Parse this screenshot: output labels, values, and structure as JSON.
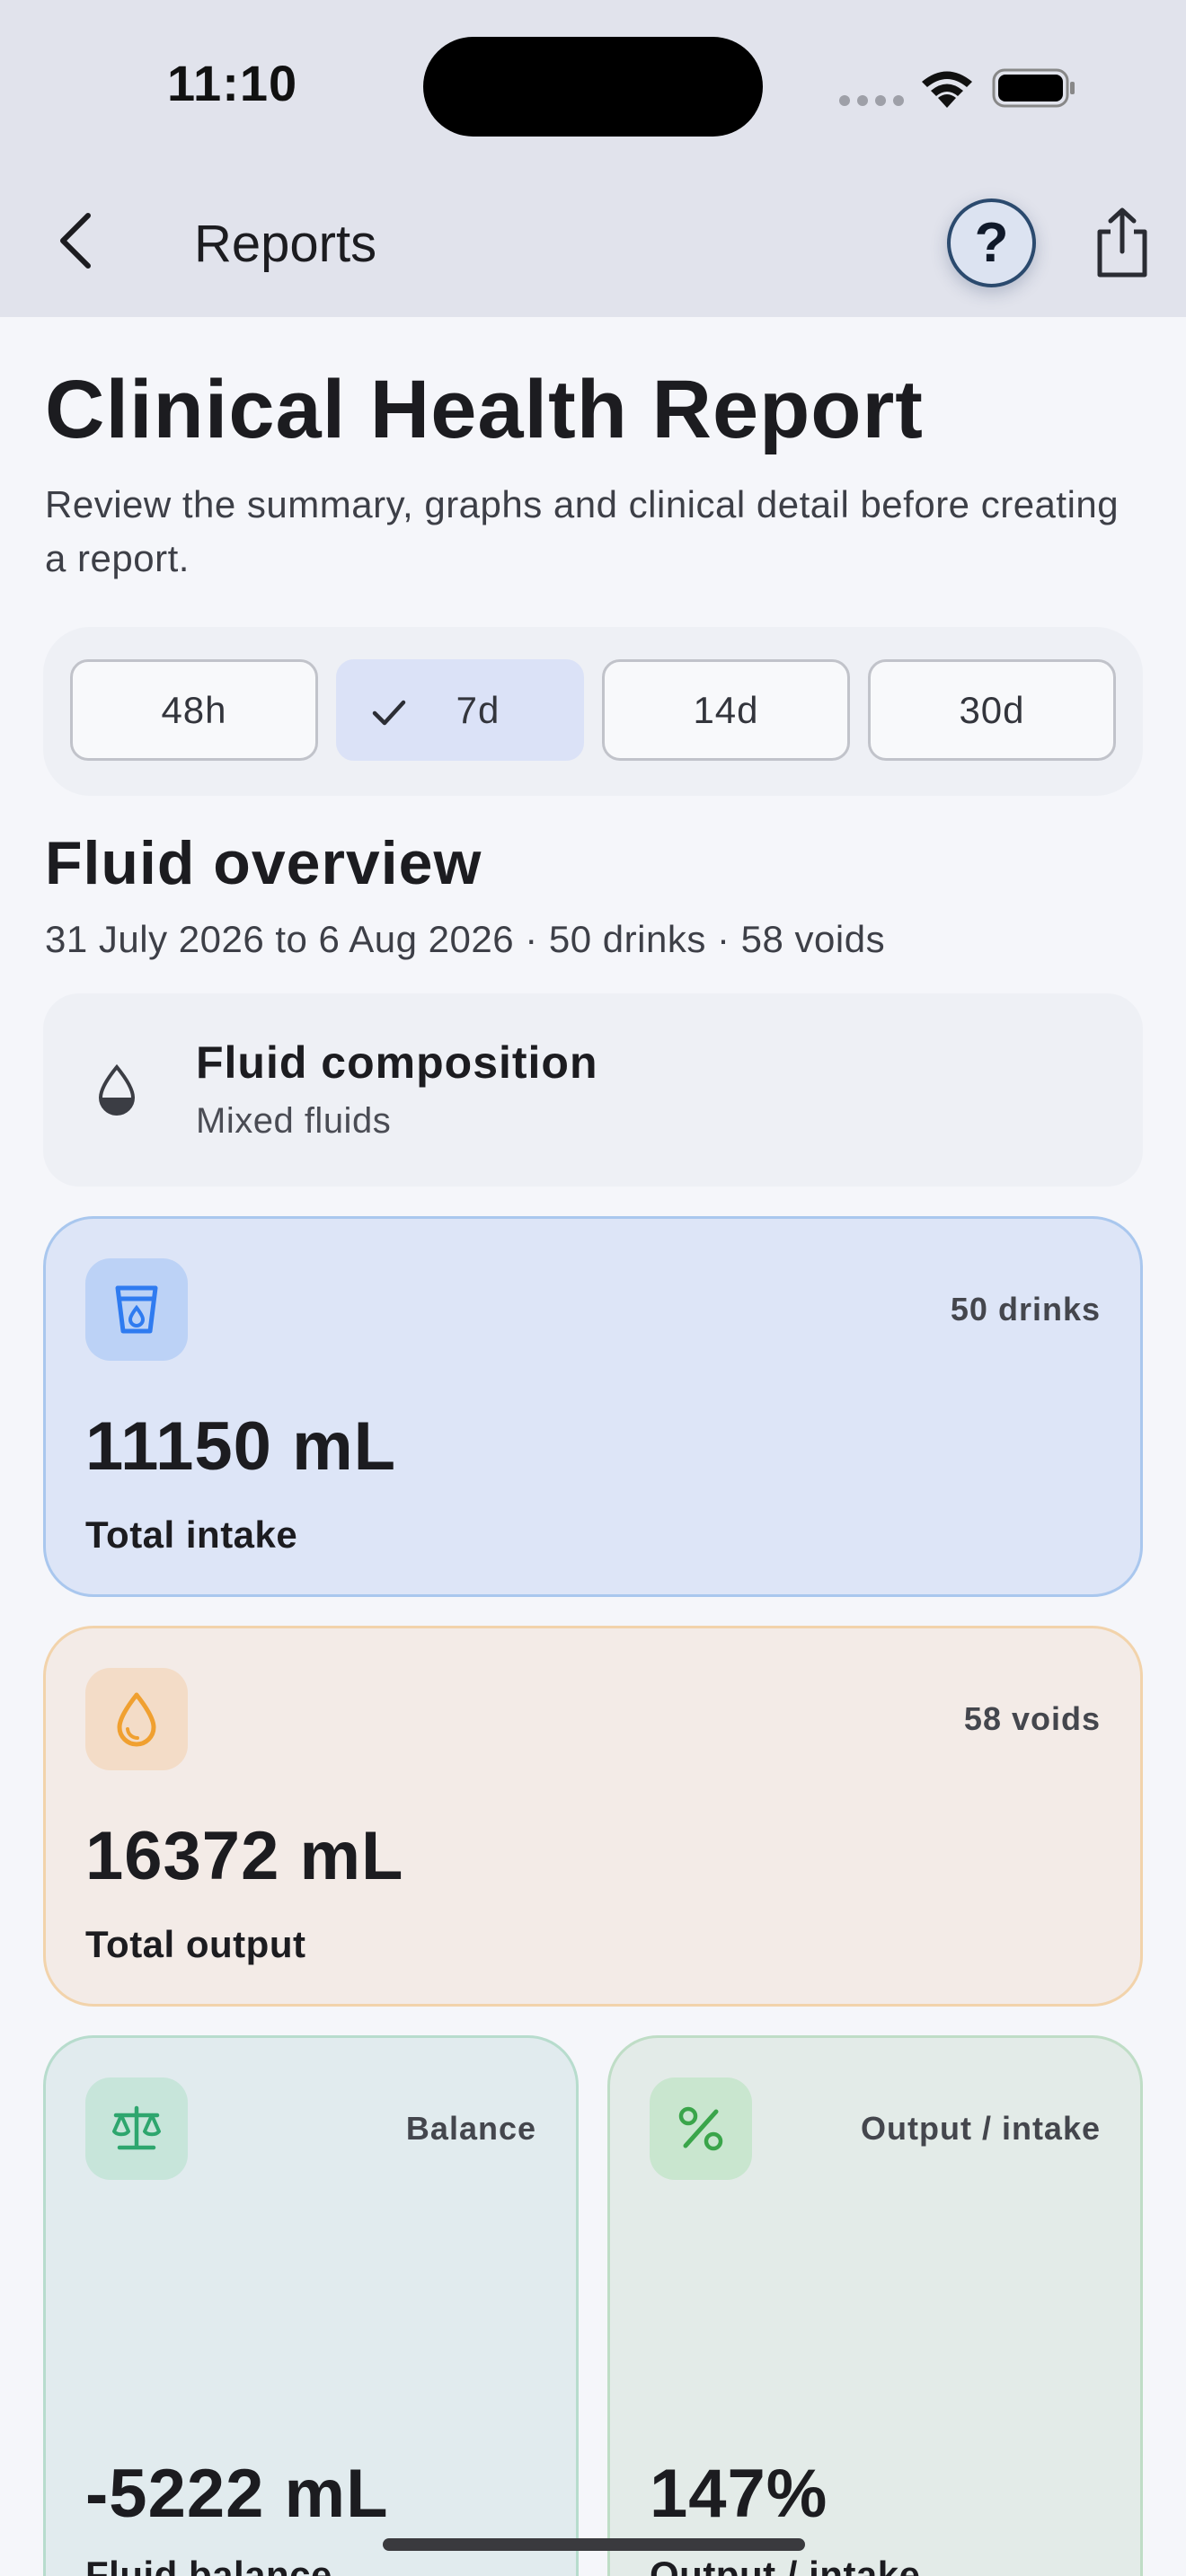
{
  "status_bar": {
    "time": "11:10"
  },
  "nav": {
    "title": "Reports",
    "help_symbol": "?"
  },
  "header": {
    "title": "Clinical Health Report",
    "subtitle": "Review the summary, graphs and clinical detail before creating a report."
  },
  "range_selector": {
    "options": [
      "48h",
      "7d",
      "14d",
      "30d"
    ],
    "selected": "7d"
  },
  "overview": {
    "title": "Fluid overview",
    "summary": "31 July 2026 to 6 Aug 2026 · 50 drinks · 58 voids"
  },
  "composition": {
    "title": "Fluid composition",
    "value": "Mixed fluids",
    "icon": "drop-half-icon"
  },
  "cards": {
    "intake": {
      "badge": "50 drinks",
      "value": "11150 mL",
      "label": "Total intake",
      "icon": "cup-icon",
      "color": "#2f7bf0"
    },
    "output": {
      "badge": "58 voids",
      "value": "16372 mL",
      "label": "Total output",
      "icon": "drop-icon",
      "color": "#f0a030"
    },
    "balance": {
      "badge": "Balance",
      "value": "-5222 mL",
      "label": "Fluid balance",
      "icon": "scale-icon",
      "color": "#2ea66e"
    },
    "ratio": {
      "badge": "Output / intake",
      "value": "147%",
      "label": "Output / intake",
      "icon": "percent-icon",
      "color": "#3aa54a"
    }
  }
}
